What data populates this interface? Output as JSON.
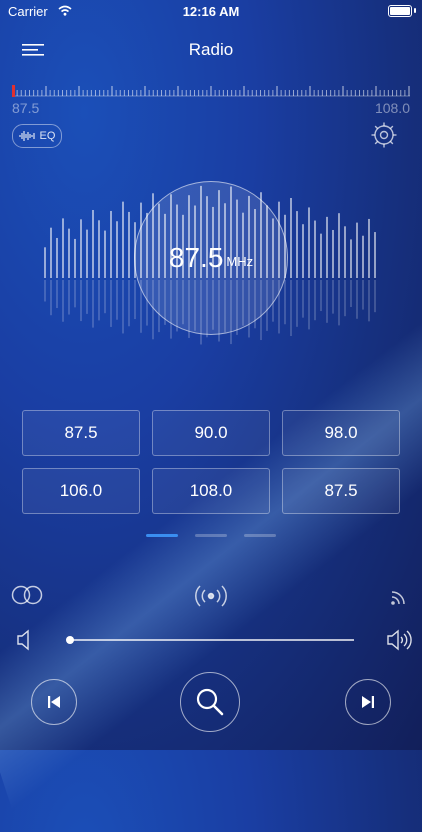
{
  "status_bar": {
    "carrier": "Carrier",
    "time": "12:16 AM"
  },
  "header": {
    "title": "Radio"
  },
  "tuner": {
    "min_label": "87.5",
    "max_label": "108.0",
    "eq_label": "EQ",
    "current_position": 0.0
  },
  "display": {
    "frequency": "87.5",
    "unit": "MHz"
  },
  "presets": [
    "87.5",
    "90.0",
    "98.0",
    "106.0",
    "108.0",
    "87.5"
  ],
  "pager": {
    "pages": 3,
    "active": 0
  },
  "volume": {
    "level": 0.0
  },
  "colors": {
    "accent": "#3a8ef0",
    "tuner_marker": "#e03030"
  },
  "icons": {
    "menu": "menu-icon",
    "eq": "waveform-icon",
    "settings": "gear-icon",
    "stereo": "stereo-rings-icon",
    "broadcast": "broadcast-icon",
    "cast": "wifi-cast-icon",
    "vol_low": "speaker-low-icon",
    "vol_high": "speaker-high-icon",
    "prev": "previous-icon",
    "search": "search-icon",
    "next": "next-icon"
  }
}
